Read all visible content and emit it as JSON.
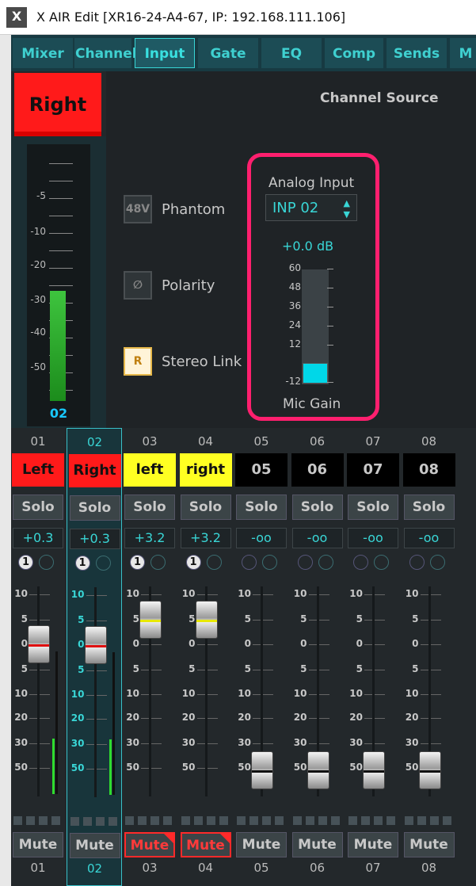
{
  "window": {
    "title": "X AIR Edit [XR16-24-A4-67, IP: 192.168.111.106]",
    "logo_text": "X"
  },
  "tabs": [
    "Mixer",
    "Channel",
    "Input",
    "Gate",
    "EQ",
    "Comp",
    "Sends",
    "M"
  ],
  "active_tab": "Input",
  "channel": {
    "name": "Right",
    "meter_number": "02",
    "meter_scale": [
      "-5",
      "-10",
      "-20",
      "-30",
      "-40",
      "-50"
    ],
    "meter_level_fraction": 0.39
  },
  "panel": {
    "title": "Channel Source",
    "phantom": {
      "label": "Phantom",
      "icon_text": "48V"
    },
    "polarity": {
      "label": "Polarity"
    },
    "stereo_link": {
      "label": "Stereo Link",
      "icon_text": "R"
    },
    "source_label": "Analog Input",
    "source_value": "INP 02",
    "gain_value": "+0.0 dB",
    "gain_scale": [
      "60",
      "48",
      "36",
      "24",
      "12",
      "-12"
    ],
    "gain_label": "Mic Gain",
    "gain_level_db": -2
  },
  "fader_scale": [
    "10",
    "5",
    "0",
    "5",
    "10",
    "20",
    "30",
    "50"
  ],
  "strips": [
    {
      "num": "01",
      "name": "Left",
      "name_bg": "#ff1a1a",
      "name_fg": "#111",
      "solo": "Solo",
      "trim": "+0.3",
      "link": "1",
      "selected": false,
      "fader_pos_db": 0,
      "mute": "Mute",
      "muted": false,
      "cap_line": "#e01010"
    },
    {
      "num": "02",
      "name": "Right",
      "name_bg": "#ff1a1a",
      "name_fg": "#111",
      "solo": "Solo",
      "trim": "+0.3",
      "link": "1",
      "selected": true,
      "fader_pos_db": 0,
      "mute": "Mute",
      "muted": false,
      "cap_line": "#e01010"
    },
    {
      "num": "03",
      "name": "left",
      "name_bg": "#ffff22",
      "name_fg": "#111",
      "solo": "Solo",
      "trim": "+3.2",
      "link": "1",
      "selected": false,
      "fader_pos_db": 5,
      "mute": "Mute",
      "muted": true,
      "cap_line": "#e8e800"
    },
    {
      "num": "04",
      "name": "right",
      "name_bg": "#ffff22",
      "name_fg": "#111",
      "solo": "Solo",
      "trim": "+3.2",
      "link": "1",
      "selected": false,
      "fader_pos_db": 5,
      "mute": "Mute",
      "muted": true,
      "cap_line": "#e8e800"
    },
    {
      "num": "05",
      "name": "05",
      "name_bg": "#000",
      "name_fg": "#c8c8c8",
      "solo": "Solo",
      "trim": "-oo",
      "link": "",
      "selected": false,
      "fader_pos_db": -90,
      "mute": "Mute",
      "muted": false,
      "cap_line": "#111"
    },
    {
      "num": "06",
      "name": "06",
      "name_bg": "#000",
      "name_fg": "#c8c8c8",
      "solo": "Solo",
      "trim": "-oo",
      "link": "",
      "selected": false,
      "fader_pos_db": -90,
      "mute": "Mute",
      "muted": false,
      "cap_line": "#111"
    },
    {
      "num": "07",
      "name": "07",
      "name_bg": "#000",
      "name_fg": "#c8c8c8",
      "solo": "Solo",
      "trim": "-oo",
      "link": "",
      "selected": false,
      "fader_pos_db": -90,
      "mute": "Mute",
      "muted": false,
      "cap_line": "#111"
    },
    {
      "num": "08",
      "name": "08",
      "name_bg": "#000",
      "name_fg": "#c8c8c8",
      "solo": "Solo",
      "trim": "-oo",
      "link": "",
      "selected": false,
      "fader_pos_db": -90,
      "mute": "Mute",
      "muted": false,
      "cap_line": "#111"
    }
  ]
}
